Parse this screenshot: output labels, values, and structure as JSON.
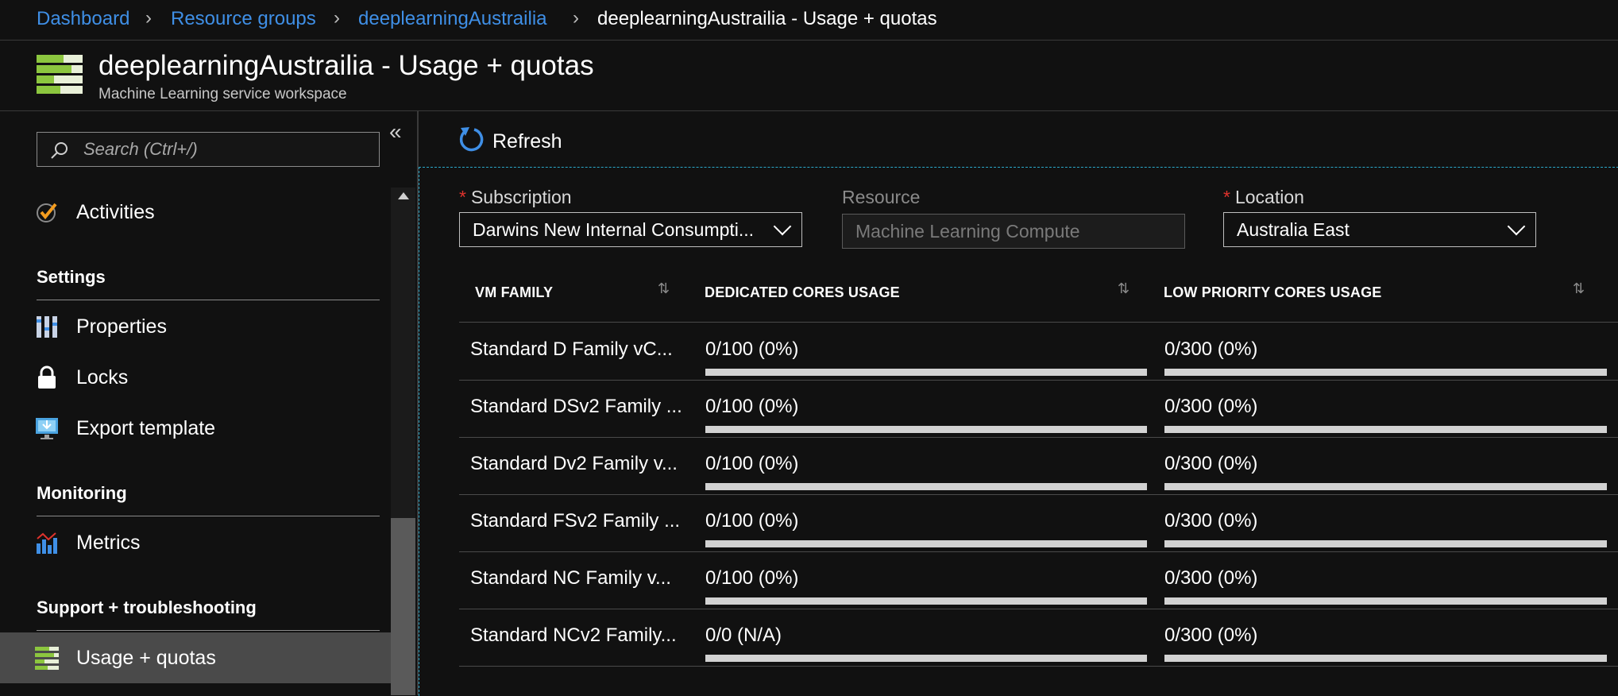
{
  "breadcrumb": {
    "items": [
      "Dashboard",
      "Resource groups",
      "deeplearningAustrailia"
    ],
    "current": "deeplearningAustrailia - Usage + quotas"
  },
  "header": {
    "title": "deeplearningAustrailia - Usage + quotas",
    "subtitle": "Machine Learning service workspace",
    "icon": "usage-quotas-icon"
  },
  "sidebar": {
    "search_placeholder": "Search (Ctrl+/)",
    "activities_label": "Activities",
    "settings_title": "Settings",
    "settings_items": [
      "Properties",
      "Locks",
      "Export template"
    ],
    "monitoring_title": "Monitoring",
    "monitoring_items": [
      "Metrics"
    ],
    "support_title": "Support + troubleshooting",
    "support_items": [
      "Usage + quotas"
    ]
  },
  "toolbar": {
    "refresh_label": "Refresh"
  },
  "filters": {
    "subscription": {
      "label": "Subscription",
      "value": "Darwins New Internal Consumpti..."
    },
    "resource": {
      "label": "Resource",
      "value": "Machine Learning Compute"
    },
    "location": {
      "label": "Location",
      "value": "Australia East"
    }
  },
  "table": {
    "columns": [
      "VM FAMILY",
      "DEDICATED CORES USAGE",
      "LOW PRIORITY CORES USAGE"
    ],
    "rows": [
      {
        "family": "Standard D Family vC...",
        "dedicated": "0/100 (0%)",
        "dedicated_pct": 0,
        "low": "0/300 (0%)",
        "low_pct": 0
      },
      {
        "family": "Standard DSv2 Family ...",
        "dedicated": "0/100 (0%)",
        "dedicated_pct": 0,
        "low": "0/300 (0%)",
        "low_pct": 0
      },
      {
        "family": "Standard Dv2 Family v...",
        "dedicated": "0/100 (0%)",
        "dedicated_pct": 0,
        "low": "0/300 (0%)",
        "low_pct": 0
      },
      {
        "family": "Standard FSv2 Family ...",
        "dedicated": "0/100 (0%)",
        "dedicated_pct": 0,
        "low": "0/300 (0%)",
        "low_pct": 0
      },
      {
        "family": "Standard NC Family v...",
        "dedicated": "0/100 (0%)",
        "dedicated_pct": 0,
        "low": "0/300 (0%)",
        "low_pct": 0
      },
      {
        "family": "Standard NCv2 Family...",
        "dedicated": "0/0 (N/A)",
        "dedicated_pct": 0,
        "low": "0/300 (0%)",
        "low_pct": 0
      }
    ]
  },
  "colors": {
    "link": "#3f8fe6",
    "required": "#e0332d",
    "accent_green": "#8cc63f"
  }
}
